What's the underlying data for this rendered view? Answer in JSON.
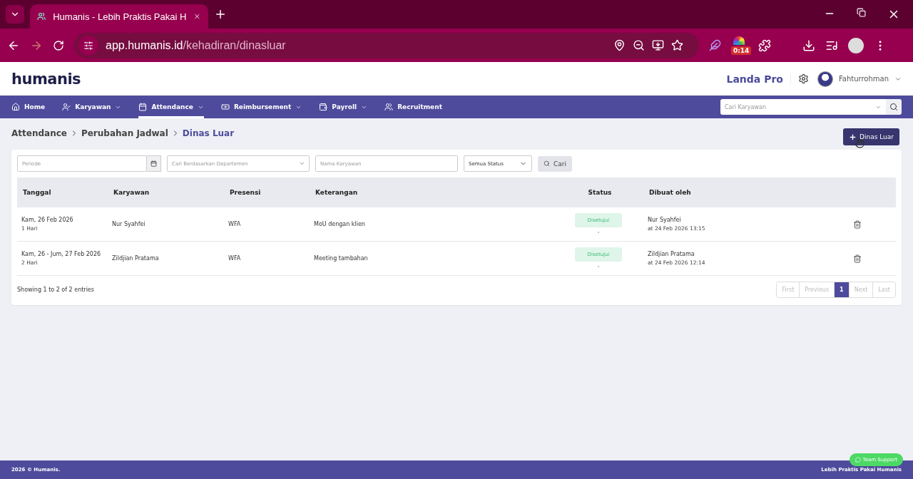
{
  "browser": {
    "tab_title": "Humanis - Lebih Praktis Pakai H",
    "url_host": "app.humanis.id",
    "url_path": "/kehadiran/dinasluar",
    "extension_badge": "0:14"
  },
  "header": {
    "logo": "humanis",
    "company": "Landa Pro",
    "user": "Fahturrohman"
  },
  "nav": {
    "items": [
      {
        "label": "Home",
        "dropdown": false,
        "selected": false
      },
      {
        "label": "Karyawan",
        "dropdown": true,
        "selected": false
      },
      {
        "label": "Attendance",
        "dropdown": true,
        "selected": true
      },
      {
        "label": "Reimbursement",
        "dropdown": true,
        "selected": false
      },
      {
        "label": "Payroll",
        "dropdown": true,
        "selected": false
      },
      {
        "label": "Recruitment",
        "dropdown": false,
        "selected": false
      }
    ],
    "search_placeholder": "Cari Karyawan"
  },
  "breadcrumb": [
    {
      "label": "Attendance",
      "selected": false
    },
    {
      "label": "Perubahan Jadwal",
      "selected": false
    },
    {
      "label": "Dinas Luar",
      "selected": true
    }
  ],
  "add_button": "Dinas Luar",
  "filters": {
    "period_placeholder": "Periode",
    "department_placeholder": "Cari Berdasarkan Departemen",
    "name_placeholder": "Nama Karyawan",
    "status_value": "Semua Status",
    "search_button": "Cari"
  },
  "table": {
    "columns": [
      "Tanggal",
      "Karyawan",
      "Presensi",
      "Keterangan",
      "Status",
      "Dibuat oleh"
    ],
    "rows": [
      {
        "date": "Kam, 26 Feb 2026",
        "duration": "1 Hari",
        "employee": "Nur Syahfei",
        "presence": "WFA",
        "note": "MoU dengan klien",
        "status": "Disetujui",
        "status_note": "-",
        "created_by": "Nur Syahfei",
        "created_at": "at 24 Feb 2026 13:15"
      },
      {
        "date": "Kam, 26 - Jum, 27 Feb 2026",
        "duration": "2 Hari",
        "employee": "Zildjian Pratama",
        "presence": "WFA",
        "note": "Meeting tambahan",
        "status": "Disetujui",
        "status_note": "-",
        "created_by": "Zildjian Pratama",
        "created_at": "at 24 Feb 2026 12:14"
      }
    ]
  },
  "entries_info": "Showing 1 to 2 of 2 entries",
  "pagination": [
    {
      "label": "First",
      "selected": false
    },
    {
      "label": "Previous",
      "selected": false
    },
    {
      "label": "1",
      "selected": true
    },
    {
      "label": "Next",
      "selected": false
    },
    {
      "label": "Last",
      "selected": false
    }
  ],
  "footer": {
    "copyright": "2026 © Humanis.",
    "support_button": "Team Support",
    "tagline": "Lebih Praktis Pakai Humanis"
  }
}
